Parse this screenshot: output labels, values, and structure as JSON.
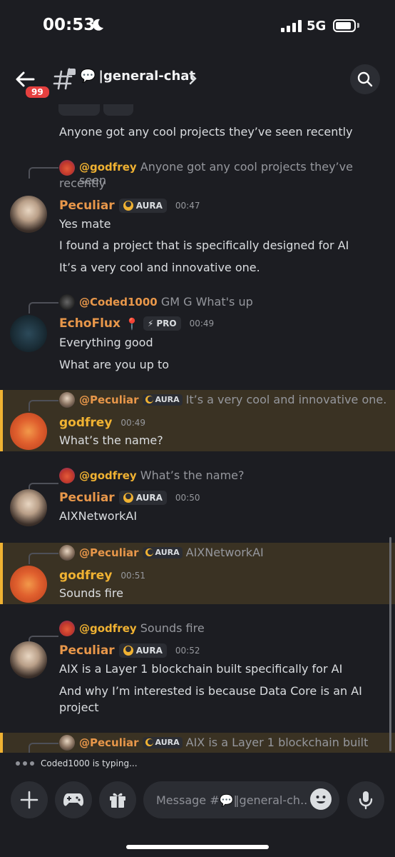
{
  "status_bar": {
    "time": "00:53",
    "network": "5G"
  },
  "header": {
    "unread_badge": "99",
    "channel_emoji": "💬",
    "channel_name": "|general-chat"
  },
  "messages": [
    {
      "text": "Anyone got any cool projects they’ve seen recently"
    },
    {
      "reply": {
        "name": "@godfrey",
        "text": "Anyone got any cool projects they’ve seen",
        "text2": "recently"
      },
      "author": "Peculiar",
      "tag": "AURA",
      "time": "00:47",
      "lines": [
        "Yes mate",
        "I found a project that is specifically designed for AI",
        "It’s a very cool and innovative one."
      ]
    },
    {
      "reply": {
        "name": "@Coded1000",
        "text": "GM G What's up"
      },
      "author": "EchoFlux",
      "author_emoji": "📍",
      "tag": "PRO",
      "tag_icon": "⚡",
      "time": "00:49",
      "lines": [
        "Everything good",
        "What are you up to"
      ]
    },
    {
      "reply": {
        "name": "@Peculiar",
        "tag": "AURA",
        "text": "It’s a very cool and innovative one."
      },
      "author": "godfrey",
      "time": "00:49",
      "lines": [
        "What’s the name?"
      ]
    },
    {
      "reply": {
        "name": "@godfrey",
        "text": "What’s the name?"
      },
      "author": "Peculiar",
      "tag": "AURA",
      "time": "00:50",
      "lines": [
        "AIXNetworkAI"
      ]
    },
    {
      "reply": {
        "name": "@Peculiar",
        "tag": "AURA",
        "text": "AIXNetworkAI"
      },
      "author": "godfrey",
      "time": "00:51",
      "lines": [
        "Sounds fire"
      ]
    },
    {
      "reply": {
        "name": "@godfrey",
        "text": "Sounds fire"
      },
      "author": "Peculiar",
      "tag": "AURA",
      "time": "00:52",
      "lines": [
        "AIX is a Layer 1 blockchain built specifically for AI",
        "And why I’m interested is because Data Core is an AI",
        "project"
      ]
    },
    {
      "reply": {
        "name": "@Peculiar",
        "tag": "AURA",
        "text": "AIX is a Layer 1 blockchain built"
      }
    }
  ],
  "typing": {
    "text": "Coded1000 is typing..."
  },
  "composer": {
    "placeholder": "Message #💬‖general-ch.."
  },
  "colors": {
    "background": "#1c1d22",
    "peculiar": "#e8974a",
    "godfrey": "#f0b232",
    "highlight": "#3a3223",
    "badge": "#e5403f"
  },
  "icons": [
    "back-arrow-icon",
    "channel-hash-lock-icon",
    "chevron-right-icon",
    "search-icon",
    "plus-icon",
    "gamepad-icon",
    "gift-icon",
    "emoji-icon",
    "microphone-icon",
    "moon-icon",
    "signal-icon",
    "battery-icon"
  ]
}
